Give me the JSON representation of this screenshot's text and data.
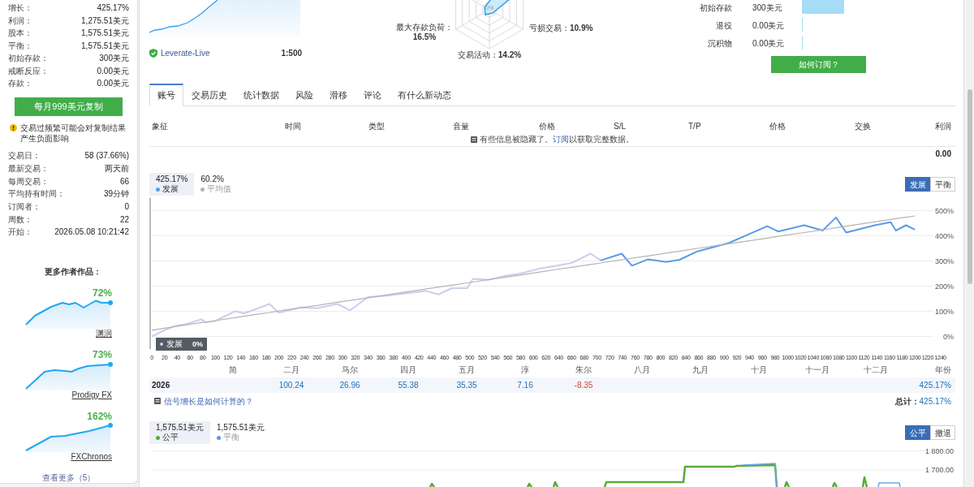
{
  "sidebar": {
    "stats": [
      {
        "label": "增长：",
        "value": "425.17%"
      },
      {
        "label": "利润：",
        "value": "1,275.51美元"
      },
      {
        "label": "股本：",
        "value": "1,575.51美元"
      },
      {
        "label": "平衡：",
        "value": "1,575.51美元"
      },
      {
        "label": "初始存款：",
        "value": "300美元"
      },
      {
        "label": "戒断反应：",
        "value": "0.00美元"
      },
      {
        "label": "存款：",
        "value": "0.00美元"
      }
    ],
    "copy_button": "每月999美元复制",
    "warning": "交易过频繁可能会对复制结果产生负面影响",
    "details": [
      {
        "label": "交易日：",
        "value": "58 (37.66%)"
      },
      {
        "label": "最新交易：",
        "value": "两天前"
      },
      {
        "label": "每周交易：",
        "value": "66"
      },
      {
        "label": "平均持有时间：",
        "value": "39分钟"
      },
      {
        "label": "订阅者：",
        "value": "0"
      },
      {
        "label": "周数：",
        "value": "22"
      },
      {
        "label": "开始：",
        "value": "2026.05.08 10:21:42"
      }
    ],
    "more_works": {
      "title": "更多作者作品：",
      "items": [
        {
          "percent": "72%",
          "name": "渊润"
        },
        {
          "percent": "73%",
          "name": "Prodigy FX"
        },
        {
          "percent": "162%",
          "name": "FXChronos"
        }
      ],
      "more_link": "查看更多（5）"
    }
  },
  "overview": {
    "account": {
      "server": "Leverate-Live",
      "leverage": "1:500"
    },
    "radar": {
      "center_label": "0%",
      "axes": [
        {
          "label": "最大存款负荷：",
          "value": "16.5%"
        },
        {
          "label": "亏损交易：",
          "value": "10.9%"
        },
        {
          "label": "交易活动：",
          "value": "14.2%"
        }
      ]
    },
    "funds_chart": {
      "chart_data": {
        "type": "bar",
        "orientation": "horizontal",
        "categories": [
          "初始存款",
          "退役",
          "沉积物"
        ],
        "values": [
          300,
          0,
          0
        ],
        "xlim": [
          0,
          300
        ],
        "value_labels": [
          "300美元",
          "0.00美元",
          "0.00美元"
        ]
      }
    },
    "subscribe_button": "如何订阅？"
  },
  "tabs": [
    {
      "label": "账号",
      "selected": true
    },
    {
      "label": "交易历史",
      "selected": false
    },
    {
      "label": "统计数据",
      "selected": false
    },
    {
      "label": "风险",
      "selected": false
    },
    {
      "label": "滑移",
      "selected": false
    },
    {
      "label": "评论",
      "selected": false
    },
    {
      "label": "有什么新动态",
      "selected": false
    }
  ],
  "trades_table": {
    "columns": [
      "象征",
      "时间",
      "类型",
      "音量",
      "价格",
      "S/L",
      "T/P",
      "价格",
      "交换",
      "利润"
    ],
    "notice": {
      "text_before": "有些信息被隐藏了。",
      "link": "订阅",
      "text_after": "以获取完整数据。"
    },
    "total": "0.00"
  },
  "growth_chart": {
    "legend": [
      {
        "value": "425.17%",
        "selected": true
      },
      {
        "value": "60.2%",
        "selected": false
      }
    ],
    "toggles": [
      {
        "label": "发展",
        "selected": true
      },
      {
        "label": "平衡",
        "selected": false
      }
    ],
    "tooltip": {
      "value": "0%"
    },
    "chart_data": {
      "type": "line",
      "grid": true,
      "x": [
        0,
        20,
        37,
        55,
        78,
        85,
        100,
        131,
        145,
        160,
        185,
        200,
        234,
        260,
        292,
        312,
        340,
        370,
        398,
        431,
        451,
        472,
        496,
        505,
        530,
        554,
        580,
        612,
        636,
        660,
        690,
        706,
        739,
        755,
        780,
        809,
        830,
        858,
        907,
        968,
        985,
        1026,
        1055,
        1076,
        1092,
        1137,
        1162,
        1170,
        1186,
        1200
      ],
      "series": [
        {
          "name": "发展",
          "color": "#c9cff0",
          "values": [
            0,
            25,
            42,
            50,
            68,
            55,
            62,
            100,
            92,
            105,
            129,
            94,
            115,
            112,
            129,
            104,
            156,
            162,
            171,
            181,
            167,
            192,
            192,
            229,
            225,
            240,
            250,
            271,
            281,
            292,
            329,
            302,
            null,
            null,
            null,
            null,
            null,
            null,
            null,
            null,
            null,
            null,
            null,
            null,
            null,
            null,
            null,
            null,
            null,
            null
          ]
        },
        {
          "name": "发展",
          "color": "#5b9be8",
          "values": [
            null,
            null,
            null,
            null,
            null,
            null,
            null,
            null,
            null,
            null,
            null,
            null,
            null,
            null,
            null,
            null,
            null,
            null,
            null,
            null,
            null,
            null,
            null,
            null,
            null,
            null,
            null,
            null,
            null,
            null,
            null,
            302,
            329,
            281,
            306,
            296,
            305,
            338,
            371,
            438,
            417,
            442,
            421,
            473,
            413,
            442,
            454,
            421,
            442,
            425
          ]
        },
        {
          "name": "平均值",
          "color": "#b4b4b4",
          "values": [
            25,
            33,
            39,
            46,
            55,
            57,
            63,
            75,
            80,
            86,
            95,
            101,
            114,
            123,
            136,
            143,
            154,
            165,
            176,
            188,
            196,
            204,
            213,
            216,
            226,
            235,
            244,
            257,
            266,
            275,
            286,
            292,
            305,
            311,
            320,
            331,
            339,
            350,
            368,
            391,
            398,
            413,
            424,
            432,
            438,
            455,
            465,
            468,
            474,
            479
          ]
        }
      ],
      "xlim": [
        0,
        1240
      ],
      "ylim": [
        -50,
        550
      ],
      "xticks": [
        0,
        20,
        40,
        60,
        80,
        100,
        120,
        140,
        160,
        180,
        200,
        220,
        240,
        260,
        280,
        300,
        320,
        340,
        360,
        380,
        400,
        420,
        440,
        460,
        480,
        500,
        520,
        540,
        560,
        580,
        600,
        620,
        640,
        660,
        680,
        700,
        720,
        740,
        760,
        780,
        800,
        820,
        840,
        860,
        880,
        900,
        920,
        940,
        960,
        980,
        1000,
        1020,
        1040,
        1060,
        1080,
        1100,
        1120,
        1140,
        1160,
        1180,
        1200,
        1220,
        1240
      ],
      "yticks": [
        {
          "value": 0,
          "label": "0%"
        },
        {
          "value": 100,
          "label": "100%"
        },
        {
          "value": 200,
          "label": "200%"
        },
        {
          "value": 300,
          "label": "300%"
        },
        {
          "value": 400,
          "label": "400%"
        },
        {
          "value": 500,
          "label": "500%"
        }
      ]
    }
  },
  "monthly_returns": {
    "months": [
      {
        "name": "简"
      },
      {
        "name": "二月",
        "value": "100.24",
        "negative": false
      },
      {
        "name": "马尔",
        "value": "26.96",
        "negative": false
      },
      {
        "name": "四月",
        "value": "55.38",
        "negative": false
      },
      {
        "name": "五月",
        "value": "35.35",
        "negative": false
      },
      {
        "name": "淳",
        "value": "7.16",
        "negative": false
      },
      {
        "name": "朱尔",
        "value": "-8.35",
        "negative": true
      },
      {
        "name": "八月"
      },
      {
        "name": "九月"
      },
      {
        "name": "十月"
      },
      {
        "name": "十一月"
      },
      {
        "name": "十二月"
      }
    ],
    "total_column": "年份",
    "year": "2026",
    "year_total": "425.17%",
    "help_link": "信号增长是如何计算的？",
    "total_label": "总计：",
    "total_value": "425.17%"
  },
  "balance_chart": {
    "legend": [
      {
        "value": "1,575.51美元",
        "label": "公平",
        "color": "#5aaa3c",
        "selected": true
      },
      {
        "value": "1,575.51美元",
        "label": "平衡",
        "color": "#5b9be8",
        "selected": false
      }
    ],
    "toggles": [
      {
        "label": "公平",
        "selected": true
      },
      {
        "label": "撤退",
        "selected": false
      }
    ],
    "y_labels": [
      "1 800.00",
      "1 700.00"
    ]
  }
}
